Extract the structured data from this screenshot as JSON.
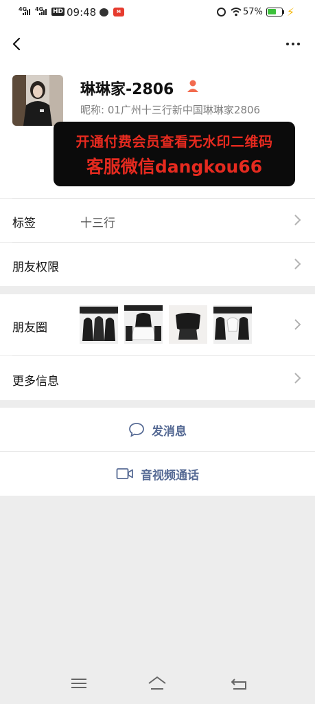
{
  "status_bar": {
    "signal1": "4G",
    "signal2": "4G",
    "hd": "HD",
    "time": "09:48",
    "app_badge": "M",
    "battery": "57%",
    "colors": {
      "battery_fill": "#3cc13b",
      "bolt": "#f4b400"
    }
  },
  "profile": {
    "name": "琳琳家-2806",
    "nickname_label": "昵称: ",
    "nickname": "01广州十三行新中国琳琳家2806"
  },
  "promo": {
    "line1": "开通付费会员查看无水印二维码",
    "line2": "客服微信dangkou66",
    "colors": {
      "background": "#0b0b0b",
      "text": "#e52a1f"
    }
  },
  "rows": {
    "tags": {
      "label": "标签",
      "value": "十三行"
    },
    "permissions": {
      "label": "朋友权限"
    },
    "moments": {
      "label": "朋友圈"
    },
    "more_info": {
      "label": "更多信息"
    }
  },
  "actions": {
    "message": "发消息",
    "call": "音视频通话",
    "link_color": "#576b95"
  },
  "icons": [
    "back-icon",
    "more-icon",
    "person-icon",
    "chevron-right-icon",
    "chat-bubble-icon",
    "video-camera-icon",
    "menu-icon",
    "home-icon",
    "return-icon"
  ]
}
